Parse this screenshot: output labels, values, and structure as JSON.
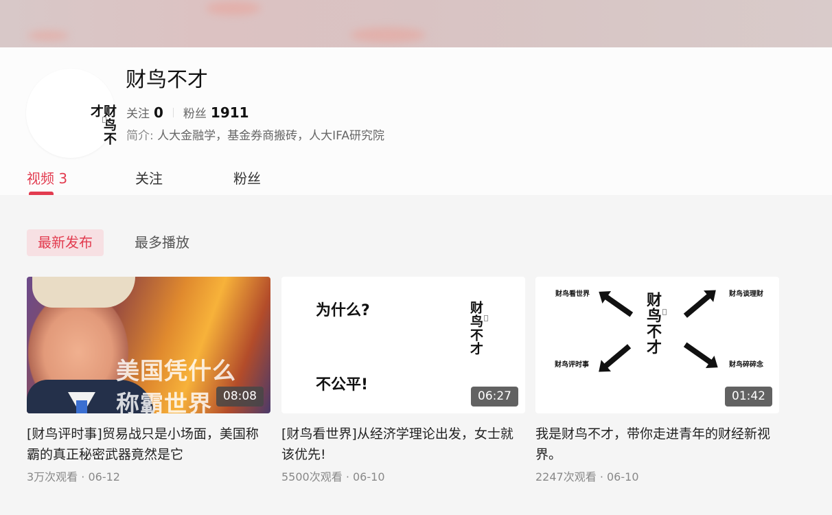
{
  "profile": {
    "avatar_text": "财鸟不才",
    "name": "财鸟不才",
    "following_label": "关注",
    "following_count": "0",
    "followers_label": "粉丝",
    "followers_count": "1911",
    "intro_label": "简介:",
    "intro_text": "人大金融学，基金券商搬砖，人大IFA研究院"
  },
  "tabs": [
    {
      "label": "视频 3",
      "active": true
    },
    {
      "label": "关注",
      "active": false
    },
    {
      "label": "粉丝",
      "active": false
    }
  ],
  "filters": [
    {
      "label": "最新发布",
      "active": true
    },
    {
      "label": "最多播放",
      "active": false
    }
  ],
  "videos": [
    {
      "title": "[财鸟评时事]贸易战只是小场面，美国称霸的真正秘密武器竟然是它",
      "duration": "08:08",
      "views": "3万次观看",
      "date": "06-12",
      "thumb_text": [
        "美国凭什么",
        "称霸世界"
      ]
    },
    {
      "title": "[财鸟看世界]从经济学理论出发，女士就该优先!",
      "duration": "06:27",
      "views": "5500次观看",
      "date": "06-10",
      "thumb_text": [
        "为什么?",
        "不公平!"
      ],
      "logo_text": "财鸟不才"
    },
    {
      "title": "我是财鸟不才，带你走进青年的财经新视界。",
      "duration": "01:42",
      "views": "2247次观看",
      "date": "06-10",
      "logo_text": "财鸟不才",
      "thumb_labels": [
        "财鸟看世界",
        "财鸟谈理财",
        "财鸟评时事",
        "财鸟碎碎念"
      ]
    }
  ],
  "colors": {
    "accent": "#e23b4f",
    "accent_bg": "#f7e0e3",
    "page_bg": "#f5f5f5"
  }
}
